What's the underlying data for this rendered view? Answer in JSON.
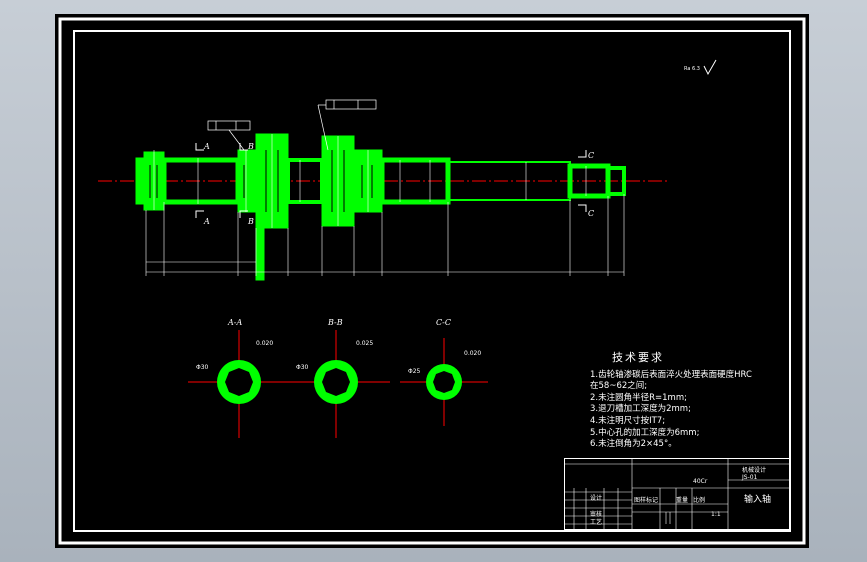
{
  "colors": {
    "background": "#000000",
    "frame": "#ffffff",
    "geometry": "#00ff00",
    "centerline": "#ff0000",
    "dimension": "#ffffff",
    "outer": "#a9b2bc"
  },
  "roughness_symbol": "Ra 6.3",
  "section_labels": {
    "a_left": "A",
    "a_right": "A",
    "b_left": "B",
    "b_right": "B",
    "c_left": "C",
    "c_right": "C"
  },
  "sections": [
    {
      "label": "A-A",
      "diameter": "Φ30",
      "tolerance": "0.020"
    },
    {
      "label": "B-B",
      "diameter": "Φ30",
      "tolerance": "0.025"
    },
    {
      "label": "C-C",
      "diameter": "Φ25",
      "tolerance": "0.020"
    }
  ],
  "tech_requirements": {
    "title": "技术要求",
    "lines": [
      "1.齿轮轴渗碳后表面淬火处理表面硬度HRC",
      "在58~62之间;",
      "2.未注圆角半径R=1mm;",
      "3.退刀槽加工深度为2mm;",
      "4.未注明尺寸按IT7;",
      "5.中心孔的加工深度为6mm;",
      "6.未注倒角为2×45°。"
    ]
  },
  "title_block": {
    "part_name": "输入轴",
    "material": "40Cr",
    "scale": "1:1",
    "company": "机械设计",
    "drawing_no": "JS-01",
    "cols": [
      "图样标记",
      "重量",
      "比例"
    ],
    "signs": [
      "设计",
      "审核",
      "工艺"
    ]
  }
}
